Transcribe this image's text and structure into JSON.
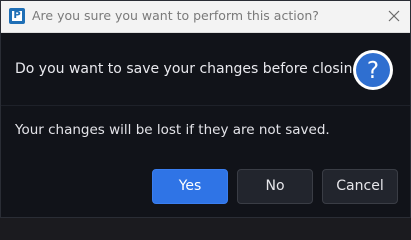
{
  "window": {
    "title": "Are you sure you want to perform this action?",
    "app_icon_letter": "P",
    "app_icon_color": "#1f6fb6"
  },
  "message": {
    "question": "Do you want to save your changes before closing?",
    "info": "Your changes will be lost if they are not saved.",
    "icon": "question-icon",
    "icon_color": "#2f6fd0"
  },
  "buttons": {
    "yes": "Yes",
    "no": "No",
    "cancel": "Cancel",
    "primary_color": "#2f74e6"
  },
  "colors": {
    "background": "#111319",
    "titlebar": "#f3f3f3"
  }
}
